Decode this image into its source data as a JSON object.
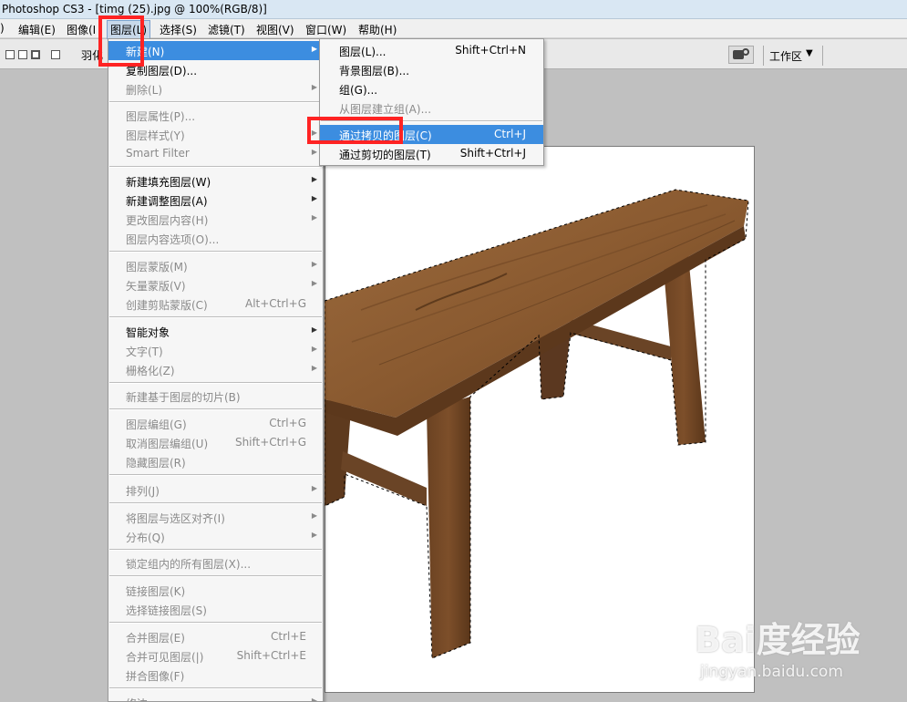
{
  "titlebar": {
    "title": "Photoshop CS3 - [timg (25).jpg @ 100%(RGB/8)]"
  },
  "menubar": {
    "items": [
      {
        "label": ")"
      },
      {
        "label": "编辑(E)"
      },
      {
        "label": "图像(I"
      },
      {
        "label": "图层(L)"
      },
      {
        "label": "选择(S)"
      },
      {
        "label": "滤镜(T)"
      },
      {
        "label": "视图(V)"
      },
      {
        "label": "窗口(W)"
      },
      {
        "label": "帮助(H)"
      }
    ]
  },
  "optionsbar": {
    "feather_label": "羽化",
    "workspace_label": "工作区",
    "workspace_arrow": "▼"
  },
  "layer_menu": {
    "items": [
      {
        "label": "新建(N)",
        "shortcut": "",
        "arrow": "▶"
      },
      {
        "label": "复制图层(D)...",
        "shortcut": "",
        "arrow": ""
      },
      {
        "label": "删除(L)",
        "shortcut": "",
        "arrow": "▶"
      },
      {
        "label": "图层属性(P)...",
        "shortcut": "",
        "arrow": ""
      },
      {
        "label": "图层样式(Y)",
        "shortcut": "",
        "arrow": "▶"
      },
      {
        "label": "Smart Filter",
        "shortcut": "",
        "arrow": "▶"
      },
      {
        "label": "新建填充图层(W)",
        "shortcut": "",
        "arrow": "▶"
      },
      {
        "label": "新建调整图层(A)",
        "shortcut": "",
        "arrow": "▶"
      },
      {
        "label": "更改图层内容(H)",
        "shortcut": "",
        "arrow": "▶"
      },
      {
        "label": "图层内容选项(O)...",
        "shortcut": "",
        "arrow": ""
      },
      {
        "label": "图层蒙版(M)",
        "shortcut": "",
        "arrow": "▶"
      },
      {
        "label": "矢量蒙版(V)",
        "shortcut": "",
        "arrow": "▶"
      },
      {
        "label": "创建剪贴蒙版(C)",
        "shortcut": "Alt+Ctrl+G",
        "arrow": ""
      },
      {
        "label": "智能对象",
        "shortcut": "",
        "arrow": "▶"
      },
      {
        "label": "文字(T)",
        "shortcut": "",
        "arrow": "▶"
      },
      {
        "label": "栅格化(Z)",
        "shortcut": "",
        "arrow": "▶"
      },
      {
        "label": "新建基于图层的切片(B)",
        "shortcut": "",
        "arrow": ""
      },
      {
        "label": "图层编组(G)",
        "shortcut": "Ctrl+G",
        "arrow": ""
      },
      {
        "label": "取消图层编组(U)",
        "shortcut": "Shift+Ctrl+G",
        "arrow": ""
      },
      {
        "label": "隐藏图层(R)",
        "shortcut": "",
        "arrow": ""
      },
      {
        "label": "排列(J)",
        "shortcut": "",
        "arrow": "▶"
      },
      {
        "label": "将图层与选区对齐(I)",
        "shortcut": "",
        "arrow": "▶"
      },
      {
        "label": "分布(Q)",
        "shortcut": "",
        "arrow": "▶"
      },
      {
        "label": "锁定组内的所有图层(X)...",
        "shortcut": "",
        "arrow": ""
      },
      {
        "label": "链接图层(K)",
        "shortcut": "",
        "arrow": ""
      },
      {
        "label": "选择链接图层(S)",
        "shortcut": "",
        "arrow": ""
      },
      {
        "label": "合并图层(E)",
        "shortcut": "Ctrl+E",
        "arrow": ""
      },
      {
        "label": "合并可见图层(|)",
        "shortcut": "Shift+Ctrl+E",
        "arrow": ""
      },
      {
        "label": "拼合图像(F)",
        "shortcut": "",
        "arrow": ""
      },
      {
        "label": "修边",
        "shortcut": "",
        "arrow": "▶"
      }
    ]
  },
  "new_submenu": {
    "items": [
      {
        "label": "图层(L)...",
        "shortcut": "Shift+Ctrl+N"
      },
      {
        "label": "背景图层(B)...",
        "shortcut": ""
      },
      {
        "label": "组(G)...",
        "shortcut": ""
      },
      {
        "label": "从图层建立组(A)...",
        "shortcut": ""
      },
      {
        "label": "通过拷贝的图层(C)",
        "shortcut": "Ctrl+J"
      },
      {
        "label": "通过剪切的图层(T)",
        "shortcut": "Shift+Ctrl+J"
      }
    ]
  },
  "watermark": {
    "logo": "Bai度经验",
    "url": "jingyan.baidu.com"
  }
}
